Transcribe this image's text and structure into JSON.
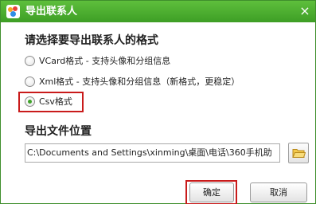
{
  "window": {
    "title": "导出联系人",
    "close_glyph": "×"
  },
  "format_section": {
    "title": "请选择要导出联系人的格式",
    "options": [
      {
        "label": "VCard格式 - 支持头像和分组信息",
        "checked": false
      },
      {
        "label": "Xml格式 - 支持头像和分组信息（新格式，更稳定）",
        "checked": false
      },
      {
        "label": "Csv格式",
        "checked": true
      }
    ]
  },
  "location_section": {
    "title": "导出文件位置",
    "path_value": "C:\\Documents and Settings\\xinming\\桌面\\电话\\360手机助"
  },
  "buttons": {
    "ok": "确定",
    "cancel": "取消"
  },
  "icons": {
    "app": "360-green-app-icon",
    "close": "close-icon",
    "browse": "folder-icon"
  },
  "colors": {
    "titlebar": "#4aad2f",
    "highlight": "#c91b1b",
    "selected_radio": "#3fa22a"
  }
}
